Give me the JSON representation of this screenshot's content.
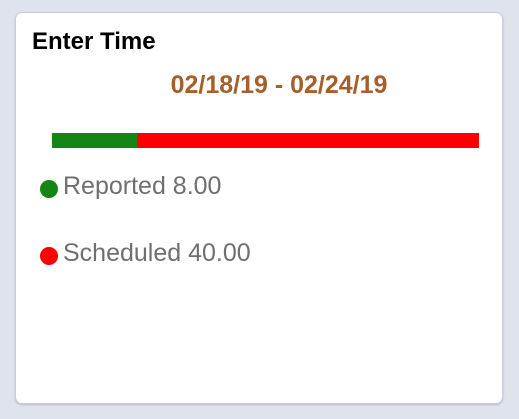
{
  "tile": {
    "title": "Enter Time",
    "date_range": "02/18/19 - 02/24/19"
  },
  "progress": {
    "reported": 8.0,
    "scheduled": 40.0,
    "reported_fraction": 0.2
  },
  "legend": {
    "reported": "Reported 8.00",
    "scheduled": "Scheduled 40.00"
  },
  "colors": {
    "date_text": "#a65f2a",
    "reported": "#138613",
    "scheduled": "#ff0000"
  },
  "icons": {
    "reported_marker": "green-dot-icon",
    "scheduled_marker": "red-dot-icon"
  }
}
